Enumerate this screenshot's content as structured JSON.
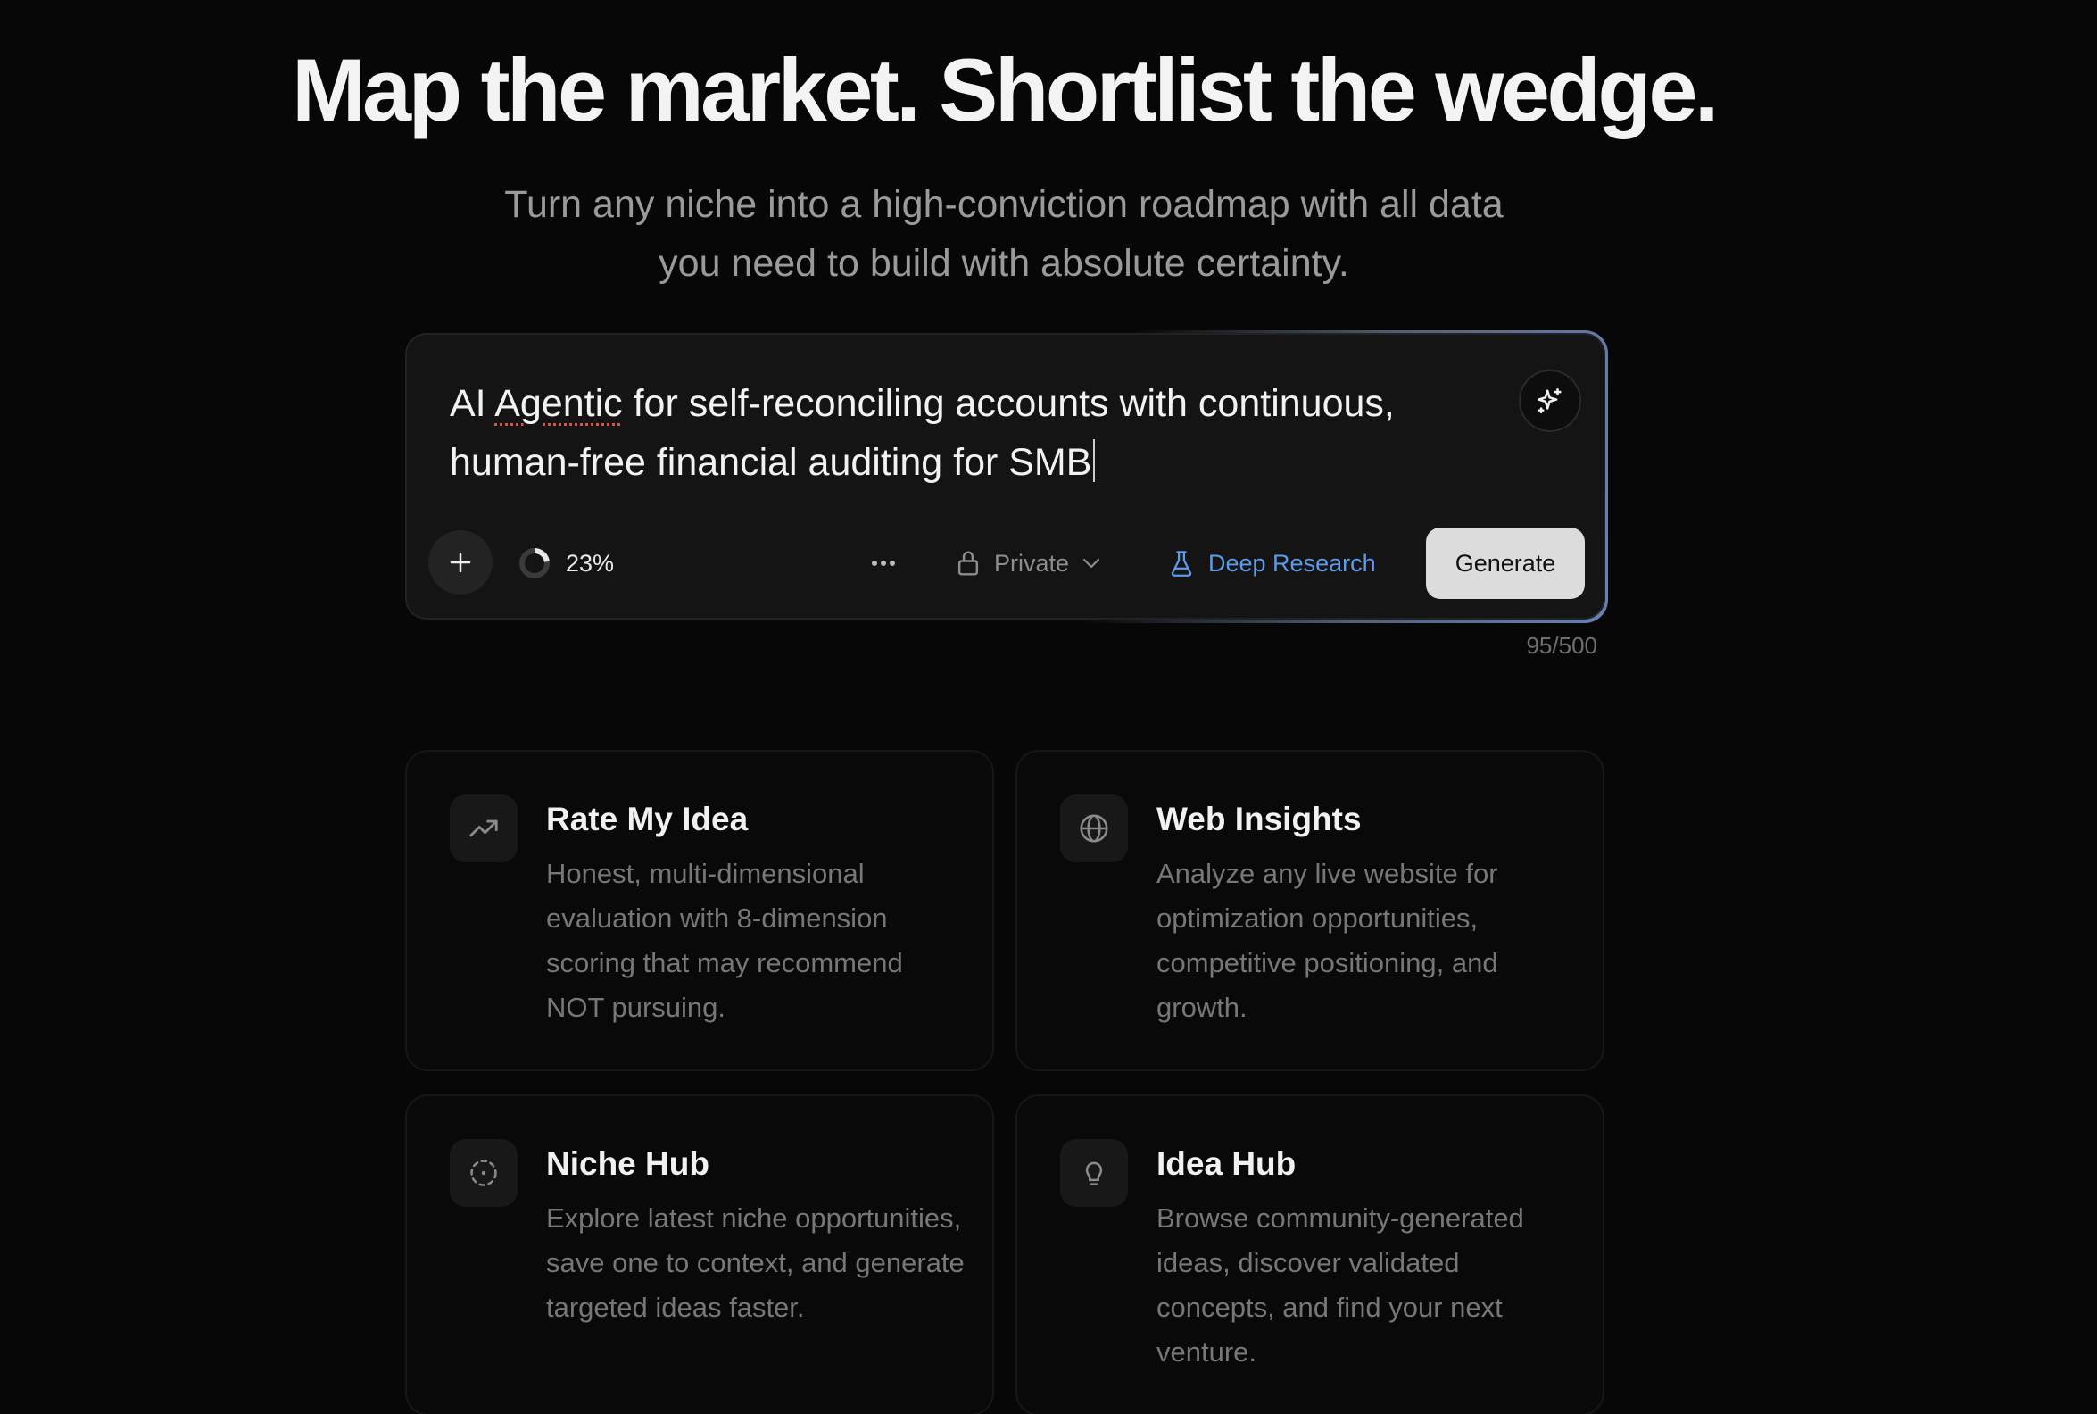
{
  "hero": {
    "title": "Map the market. Shortlist the wedge.",
    "subtitle": "Turn any niche into a high-conviction roadmap with all data you need to build with absolute certainty."
  },
  "prompt": {
    "text_before": "AI ",
    "misspelled_word": "Agentic",
    "text_after": " for self-reconciling accounts with continuous, human-free financial auditing for SMB",
    "enhance_icon": "sparkles-icon",
    "progress_percent": 23,
    "progress_label": "23%",
    "visibility_label": "Private",
    "mode_label": "Deep Research",
    "generate_label": "Generate",
    "char_count": "95/500",
    "colors": {
      "accent": "#5b9bea",
      "generate_bg": "#dcdcdc"
    }
  },
  "cards": [
    {
      "icon": "trending-up-icon",
      "title": "Rate My Idea",
      "description": "Honest, multi-dimensional evaluation with 8-dimension scoring that may recommend NOT pursuing."
    },
    {
      "icon": "globe-icon",
      "title": "Web Insights",
      "description": "Analyze any live website for optimization opportunities, competitive positioning, and growth."
    },
    {
      "icon": "dashed-circle-icon",
      "title": "Niche Hub",
      "description": "Explore latest niche opportunities, save one to context, and generate targeted ideas faster."
    },
    {
      "icon": "lightbulb-icon",
      "title": "Idea Hub",
      "description": "Browse community-generated ideas, discover validated concepts, and find your next venture."
    }
  ]
}
